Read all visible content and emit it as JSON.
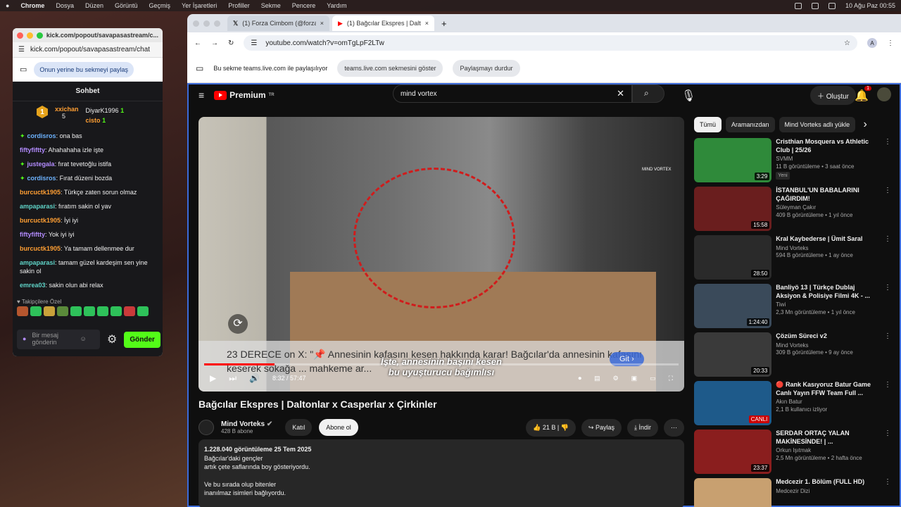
{
  "menubar": {
    "app": "Chrome",
    "items": [
      "Dosya",
      "Düzen",
      "Görüntü",
      "Geçmiş",
      "Yer İşaretleri",
      "Profiller",
      "Sekme",
      "Pencere",
      "Yardım"
    ],
    "clock": "10 Ağu Paz  00:55"
  },
  "popup": {
    "title": "kick.com/popout/savapasastream/c...",
    "url": "kick.com/popout/savapasastream/chat",
    "share_label": "Onun yerine bu sekmeyi paylaş",
    "chat_header": "Sohbet",
    "leader": {
      "rank": "1",
      "name": "xxichan",
      "count": "5",
      "user2": "DiyarK1996",
      "user2_count": "1",
      "user3": "cisto",
      "user3_count": "1"
    },
    "messages": [
      {
        "user": "cordisros",
        "text": ": ona bas"
      },
      {
        "user": "fiftyfiftty",
        "text": ": Ahahahaha izle işte"
      },
      {
        "user": "justegala",
        "text": ": fırat tevetoğlu istifa"
      },
      {
        "user": "cordisros",
        "text": ": Fırat düzeni bozda"
      },
      {
        "user": "burcuctk1905",
        "text": ": Türkçe zaten sorun olmaz"
      },
      {
        "user": "ampaparasi",
        "text": ": fıratım sakin ol yav"
      },
      {
        "user": "burcuctk1905",
        "text": ": İyi iyi"
      },
      {
        "user": "fiftyfiftty",
        "text": ": Yok iyi iyi"
      },
      {
        "user": "burcuctk1905",
        "text": ": Ya tamam dellenmee dur"
      },
      {
        "user": "ampaparasi",
        "text": ": tamam güzel kardeşim sen yine sakin ol"
      },
      {
        "user": "emrea03",
        "text": ": sakin olun abi relax"
      }
    ],
    "followers_only": "Takipçilere Özel",
    "input_placeholder": "Bir mesaj gönderin",
    "send_label": "Gönder"
  },
  "browser": {
    "tabs": [
      {
        "label": "(1) Forza Cimbom (@forzacim..."
      },
      {
        "label": "(1) Bağcılar Ekspres | Dalt..."
      }
    ],
    "url": "youtube.com/watch?v=omTgLpF2LTw",
    "share_text": "Bu sekme teams.live.com ile paylaşılıyor",
    "share_show": "teams.live.com sekmesini göster",
    "share_stop": "Paylaşmayı durdur"
  },
  "youtube": {
    "logo": "Premium",
    "logo_sup": "TR",
    "search_value": "mind vortex",
    "create_label": "Oluştur",
    "notif_count": "1",
    "ad_text": "23 DERECE on X: \"📌 Annesinin kafasını kesen hakkında karar! Bağcılar'da annesinin kafasını keserek sokağa ... mahkeme ar...",
    "ad_button": "Git",
    "caption_line1": "İşte, annesinin başını kesen",
    "caption_line2": "bu uyuşturucu bağımlısı",
    "time": "8:32 / 57:47",
    "progress": 0.148,
    "watermark": "MIND VORTEX",
    "video_title": "Bağcılar Ekspres | Daltonlar x Casperlar x Çirkinler",
    "channel": "Mind Vorteks",
    "subs": "428 B abone",
    "join": "Katıl",
    "subscribe": "Abone ol",
    "likes": "21 B",
    "share": "Paylaş",
    "download": "İndir",
    "desc_stats": "1.228.040 görüntüleme  25 Tem 2025",
    "desc_lines": [
      "Bağcılar'daki gençler",
      "artık çete saflarında boy gösteriyordu.",
      "",
      "Ve bu sırada olup bitenler",
      "inanılmaz isimleri bağlıyordu."
    ],
    "chips": [
      "Tümü",
      "Aramanızdan",
      "Mind Vorteks adlı yükle"
    ],
    "recs": [
      {
        "title": "Cristhian Mosquera vs Athletic Club | 25/26",
        "channel": "SVMM",
        "meta": "11 B görüntüleme • 3 saat önce",
        "badge": "Yeni",
        "dur": "3:29",
        "color": "#2f8a3a"
      },
      {
        "title": "İSTANBUL'UN BABALARINI ÇAĞIRDIM!",
        "channel": "Süleyman Çakır",
        "meta": "409 B görüntüleme • 1 yıl önce",
        "badge": "",
        "dur": "15:58",
        "color": "#6a1e1e"
      },
      {
        "title": "Kral Kaybederse | Ümit Saral",
        "channel": "Mind Vorteks",
        "meta": "594 B görüntüleme • 1 ay önce",
        "badge": "",
        "dur": "28:50",
        "color": "#2a2a2a"
      },
      {
        "title": "Banliyö 13 | Türkçe Dublaj Aksiyon & Polisiye Filmi 4K - ...",
        "channel": "Tiwi",
        "meta": "2,3 Mn görüntüleme • 1 yıl önce",
        "badge": "",
        "dur": "1:24:40",
        "color": "#3a4a5a"
      },
      {
        "title": "Çözüm Süreci v2",
        "channel": "Mind Vorteks",
        "meta": "309 B görüntüleme • 9 ay önce",
        "badge": "",
        "dur": "20:33",
        "color": "#3a3a3a"
      },
      {
        "title": "🔴 Rank Kasıyoruz Batur Game Canlı Yayın  FFW Team Full ...",
        "channel": "Akın Batur",
        "meta": "2,1 B kullanıcı izliyor",
        "badge": "",
        "dur": "CANLI",
        "color": "#1e5a8a"
      },
      {
        "title": "SERDAR ORTAÇ YALAN MAKİNESİNDE! | ...",
        "channel": "Orkun Işıtmak",
        "meta": "2,5 Mn görüntüleme • 2 hafta önce",
        "badge": "",
        "dur": "23:37",
        "color": "#8a1e1e"
      },
      {
        "title": "Medcezir 1. Bölüm (FULL HD)",
        "channel": "Medcezir Dizi",
        "meta": "",
        "badge": "",
        "dur": "",
        "color": "#c8a070"
      }
    ]
  }
}
